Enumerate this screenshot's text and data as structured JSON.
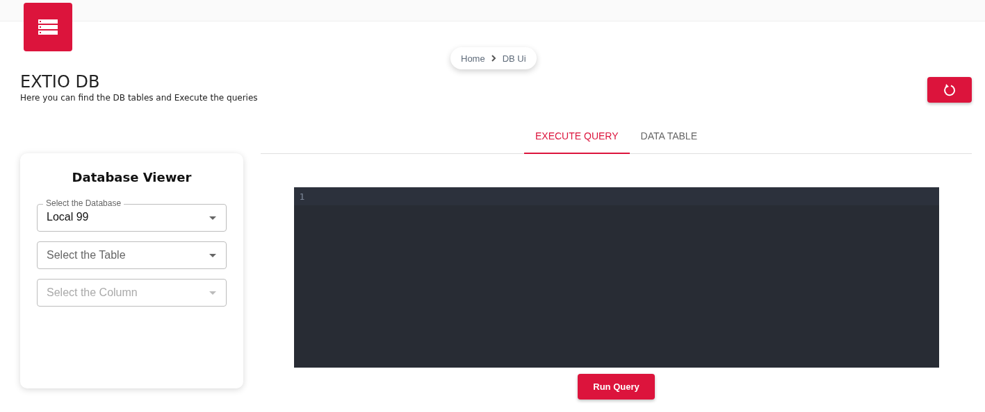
{
  "breadcrumb": [
    {
      "label": "Home"
    },
    {
      "label": "DB Ui"
    }
  ],
  "header": {
    "title": "EXTIO DB",
    "subtitle": "Here you can find the DB tables and Execute the queries"
  },
  "viewer": {
    "title": "Database Viewer",
    "selects": [
      {
        "label": "Select the Database",
        "value": "Local 99",
        "disabled": false
      },
      {
        "placeholder": "Select the Table",
        "disabled": false
      },
      {
        "placeholder": "Select the Column",
        "disabled": true
      }
    ]
  },
  "tabs": [
    {
      "label": "EXECUTE QUERY",
      "selected": true
    },
    {
      "label": "DATA TABLE",
      "selected": false
    }
  ],
  "editor": {
    "line_numbers": [
      "1"
    ]
  },
  "run_button": "Run Query"
}
